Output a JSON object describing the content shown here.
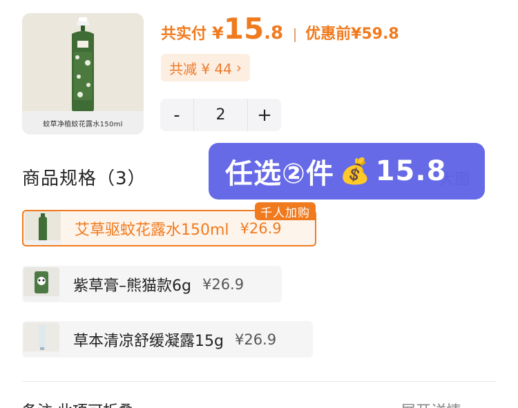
{
  "product": {
    "thumb_caption": "蚊草净植蚊花露水150ml",
    "thumb_icon": "spray-bottle-icon"
  },
  "price": {
    "total_label": "共实付",
    "yen": "¥",
    "total_int": "15",
    "total_dec": ".8",
    "before_label": "优惠前¥59.8"
  },
  "discount": {
    "label": "共减 ¥ 44",
    "chevron": "›"
  },
  "stepper": {
    "minus": "-",
    "qty": "2",
    "plus": "+"
  },
  "spec": {
    "title": "商品规格（3）",
    "view_large": "大图"
  },
  "promo": {
    "text_before": "任选②件",
    "bag": "💰",
    "text_after": "15.8"
  },
  "options": [
    {
      "name": "艾草驱蚊花露水150ml",
      "price": "¥26.9",
      "selected": true
    },
    {
      "name": "紫草膏–熊猫款6g",
      "price": "¥26.9",
      "selected": false
    },
    {
      "name": "草本清凉舒缓凝露15g",
      "price": "¥26.9",
      "selected": false
    }
  ],
  "hot_tag": "千人加购",
  "footer": {
    "remark": "备注 此项可折叠",
    "expand": "展开详情"
  },
  "colors": {
    "accent": "#f07a1e",
    "promo_banner": "#5e62e6"
  }
}
